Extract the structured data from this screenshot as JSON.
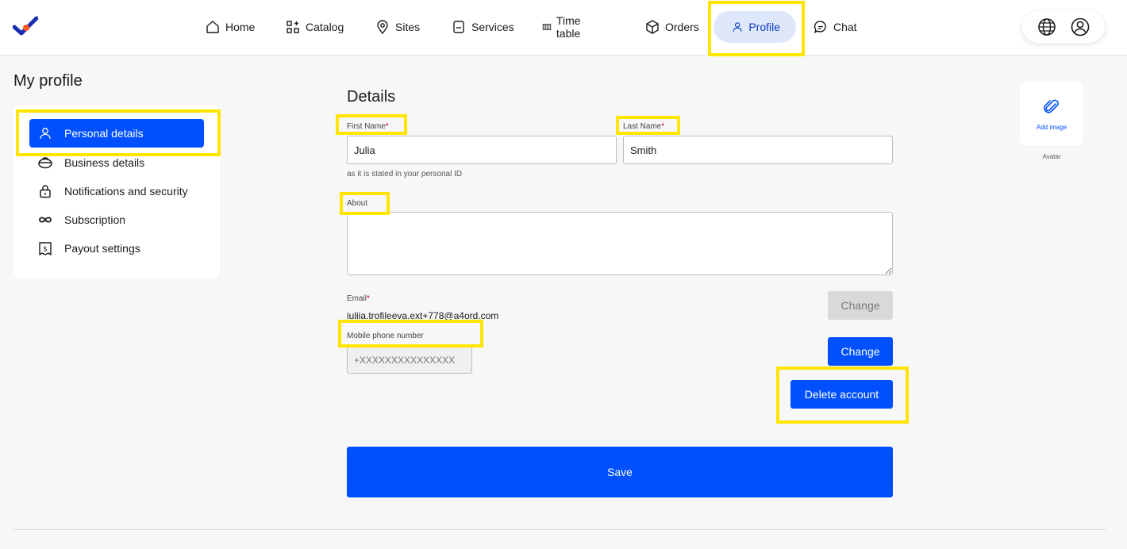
{
  "nav": {
    "items": [
      {
        "label": "Home",
        "icon": "home-icon"
      },
      {
        "label": "Catalog",
        "icon": "catalog-icon"
      },
      {
        "label": "Sites",
        "icon": "location-pin-icon"
      },
      {
        "label": "Services",
        "icon": "services-icon"
      },
      {
        "label": "Time table",
        "icon": "table-icon"
      },
      {
        "label": "Orders",
        "icon": "box-icon"
      },
      {
        "label": "Profile",
        "icon": "user-icon",
        "active": true
      },
      {
        "label": "Chat",
        "icon": "chat-bubble-icon"
      }
    ]
  },
  "utilities": {
    "language_icon": "globe-icon",
    "account_icon": "account-circle-icon"
  },
  "page": {
    "title": "My profile"
  },
  "sidebar": {
    "items": [
      {
        "label": "Personal details",
        "icon": "user-icon",
        "active": true
      },
      {
        "label": "Business details",
        "icon": "briefcase-icon"
      },
      {
        "label": "Notifications and security",
        "icon": "lock-icon"
      },
      {
        "label": "Subscription",
        "icon": "infinity-icon"
      },
      {
        "label": "Payout settings",
        "icon": "payout-icon"
      }
    ]
  },
  "form": {
    "title": "Details",
    "first_name": {
      "label": "First Name",
      "required_mark": "*",
      "value": "Julia",
      "hint": "as it is stated in your personal ID"
    },
    "last_name": {
      "label": "Last Name",
      "required_mark": "*",
      "value": "Smith"
    },
    "about": {
      "label": "About",
      "value": ""
    },
    "email": {
      "label": "Email",
      "required_mark": "*",
      "value": "iuliia.trofileeva.ext+778@a4ord.com",
      "change_label": "Change"
    },
    "phone": {
      "label": "Mobile phone number",
      "placeholder": "+XXXXXXXXXXXXXXX",
      "change_label": "Change"
    },
    "delete_label": "Delete account",
    "save_label": "Save"
  },
  "avatar": {
    "add_label": "Add image",
    "caption": "Avatar"
  },
  "colors": {
    "accent": "#0050ff",
    "highlight": "#ffe600",
    "active_nav_bg": "#dfe7fb"
  }
}
